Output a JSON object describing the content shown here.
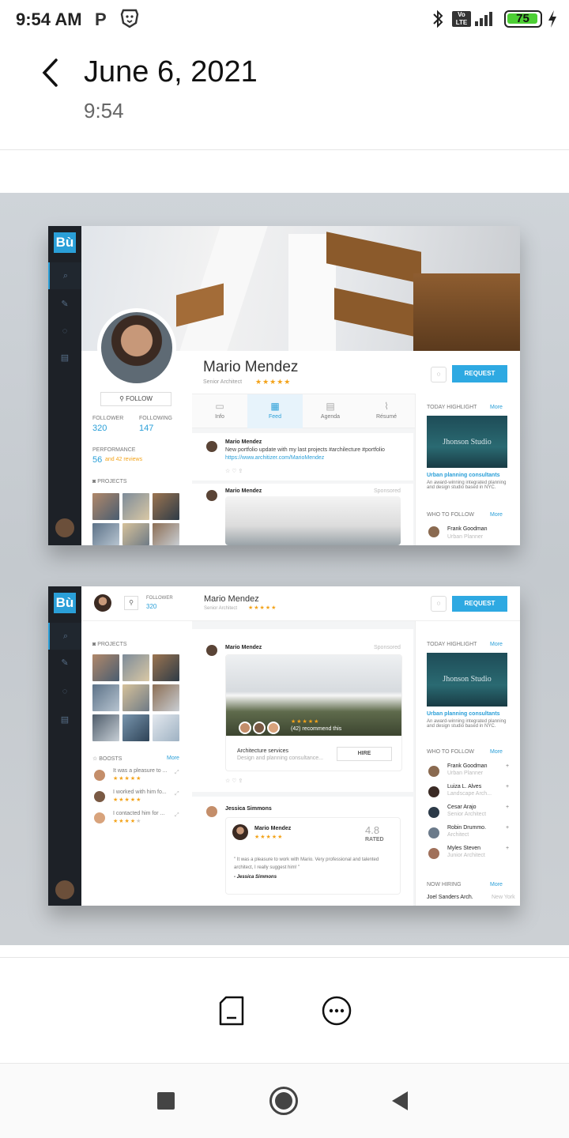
{
  "status_bar": {
    "time": "9:54 AM",
    "battery": "75"
  },
  "header": {
    "date": "June 6, 2021",
    "time": "9:54"
  },
  "mock1": {
    "logo": "Bù",
    "name": "Mario Mendez",
    "title": "Senior Architect",
    "follow": "FOLLOW",
    "follower_label": "FOLLOWER",
    "follower_count": "320",
    "following_label": "FOLLOWING",
    "following_count": "147",
    "performance_label": "PERFORMANCE",
    "performance_value": "56",
    "performance_reviews": "and 42 reviews",
    "projects_label": "PROJECTS",
    "request": "REQUEST",
    "tabs": [
      "Info",
      "Feed",
      "Agenda",
      "Résumé"
    ],
    "post1_author": "Mario Mendez",
    "post1_text": "New portfolio update with my last projects #archilecture #portfolio",
    "post1_link": "https://www.architizer.com/MarioMendez",
    "post2_author": "Mario Mendez",
    "post2_sponsored": "Sponsored",
    "highlight_label": "TODAY HIGHLIGHT",
    "more": "More",
    "highlight_brand": "Jhonson Studio",
    "highlight_title": "Urban planning consultants",
    "highlight_desc": "An award-winning integrated planning and design studio based in NYC.",
    "who_to_follow": "WHO TO FOLLOW",
    "follow1_name": "Frank Goodman",
    "follow1_role": "Urban Planner"
  },
  "mock2": {
    "logo": "Bù",
    "follower_label": "FOLLOWER",
    "follower_count": "320",
    "name": "Mario Mendez",
    "title": "Senior Architect",
    "request": "REQUEST",
    "projects_label": "PROJECTS",
    "boosts_label": "BOOSTS",
    "more": "More",
    "boosts": [
      "It was a pleasure to ...",
      "I worked with him fo...",
      "I contacted him for ..."
    ],
    "post_author": "Mario Mendez",
    "sponsored": "Sponsored",
    "recommend": "(42) recommend this",
    "service_title": "Architecture services",
    "service_desc": "Design and planning consultance...",
    "hire": "HIRE",
    "post2_author": "Jessica Simmons",
    "review_name": "Mario Mendez",
    "rating": "4.8",
    "rated": "RATED",
    "quote": "\" It was a pleasure to work with Mario. Very professional and talented architect, I really suggest him! \"",
    "quote_author": "- Jessica Simmons",
    "highlight_label": "TODAY HIGHLIGHT",
    "highlight_brand": "Jhonson Studio",
    "highlight_title": "Urban planning consultants",
    "highlight_desc": "An award-winning integrated planning and design studio based in NYC.",
    "who_to_follow": "WHO TO FOLLOW",
    "people": [
      {
        "name": "Frank Goodman",
        "role": "Urban Planner"
      },
      {
        "name": "Luiza L. Alves",
        "role": "Landscape Arch..."
      },
      {
        "name": "Cesar Arajo",
        "role": "Senior Architect"
      },
      {
        "name": "Robin Drummo.",
        "role": "Architect"
      },
      {
        "name": "Myles Steven",
        "role": "Junior Architect"
      }
    ],
    "now_hiring": "NOW HIRING",
    "hiring_name": "Joel Sanders Arch.",
    "hiring_loc": "New York"
  },
  "colors": {
    "accent": "#2ea9e2",
    "rail": "#1d2127",
    "star": "#f3a31a"
  }
}
